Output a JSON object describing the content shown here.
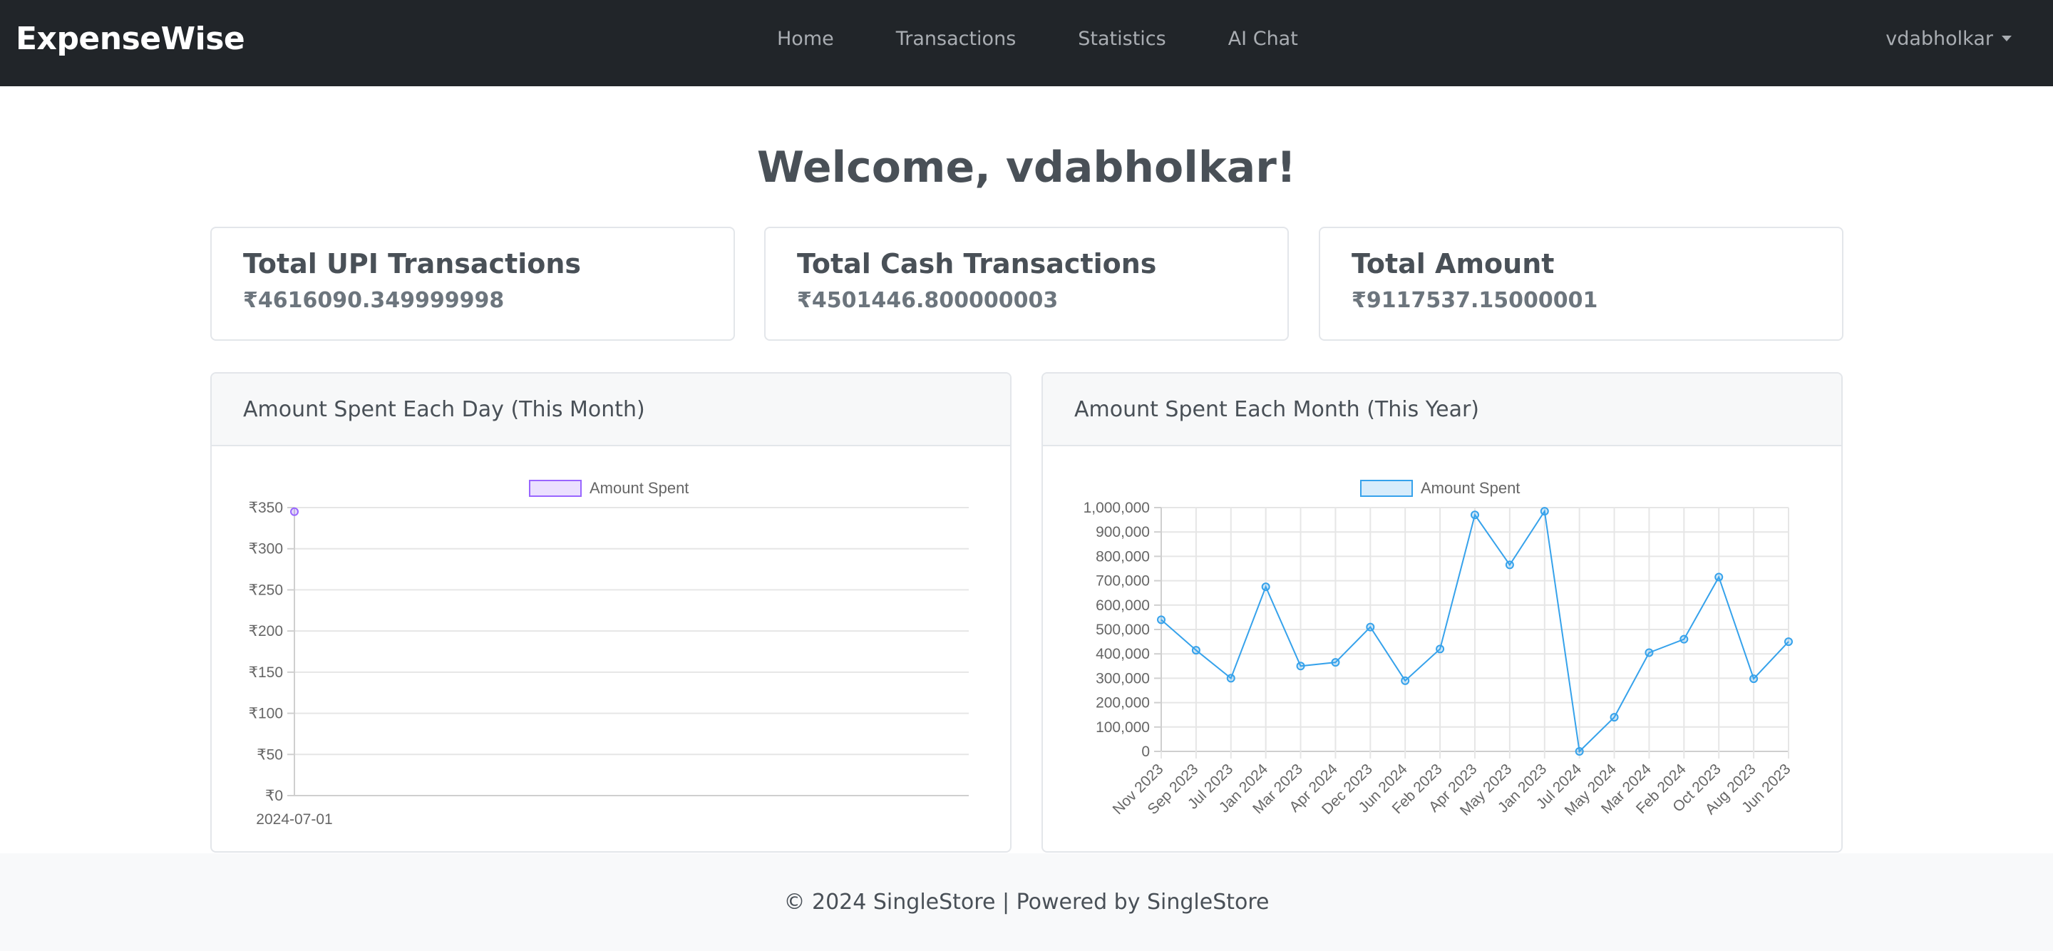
{
  "nav": {
    "brand": "ExpenseWise",
    "links": [
      "Home",
      "Transactions",
      "Statistics",
      "AI Chat"
    ],
    "user": "vdabholkar"
  },
  "welcome": "Welcome, vdabholkar!",
  "stats": [
    {
      "title": "Total UPI Transactions",
      "value": "₹4616090.349999998"
    },
    {
      "title": "Total Cash Transactions",
      "value": "₹4501446.800000003"
    },
    {
      "title": "Total Amount",
      "value": "₹9117537.15000001"
    }
  ],
  "daily_chart": {
    "header": "Amount Spent Each Day (This Month)"
  },
  "monthly_chart": {
    "header": "Amount Spent Each Month (This Year)"
  },
  "footer": "© 2024 SingleStore | Powered by SingleStore",
  "colors": {
    "navbar": "#212529",
    "daily_line": "#9966ff",
    "monthly_line": "#36a2eb"
  },
  "chart_data": [
    {
      "type": "line",
      "title": "",
      "categories": [
        "2024-07-01"
      ],
      "series": [
        {
          "name": "Amount Spent",
          "values": [
            345
          ]
        }
      ],
      "yticks": [
        "₹0",
        "₹50",
        "₹100",
        "₹150",
        "₹200",
        "₹250",
        "₹300",
        "₹350"
      ],
      "ylim": [
        0,
        350
      ],
      "grid": true,
      "legend": "top"
    },
    {
      "type": "line",
      "title": "",
      "categories": [
        "Nov 2023",
        "Sep 2023",
        "Jul 2023",
        "Jan 2024",
        "Mar 2023",
        "Apr 2024",
        "Dec 2023",
        "Jun 2024",
        "Feb 2023",
        "Apr 2023",
        "May 2023",
        "Jan 2023",
        "Jul 2024",
        "May 2024",
        "Mar 2024",
        "Feb 2024",
        "Oct 2023",
        "Aug 2023",
        "Jun 2023"
      ],
      "series": [
        {
          "name": "Amount Spent",
          "values": [
            540000,
            415000,
            300000,
            675000,
            350000,
            365000,
            510000,
            290000,
            420000,
            970000,
            765000,
            985000,
            0,
            140000,
            405000,
            460000,
            715000,
            298000,
            450000
          ]
        }
      ],
      "yticks": [
        "0",
        "100,000",
        "200,000",
        "300,000",
        "400,000",
        "500,000",
        "600,000",
        "700,000",
        "800,000",
        "900,000",
        "1,000,000"
      ],
      "ylim": [
        0,
        1000000
      ],
      "grid": true,
      "legend": "top"
    }
  ]
}
